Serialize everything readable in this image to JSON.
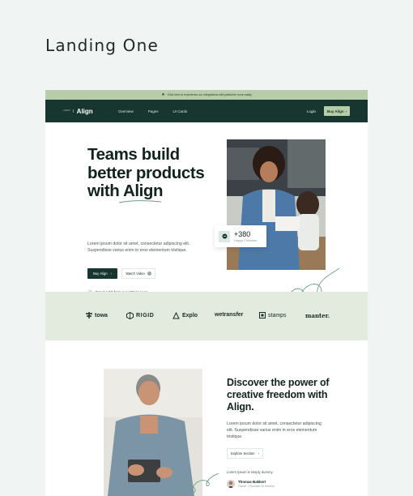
{
  "page_title": "Landing One",
  "announcement": {
    "text": "Click here to experience our integrations with platforms more easily"
  },
  "nav": {
    "brand_mark": "LOGO",
    "brand": "Align",
    "links": [
      "Overview",
      "Pages",
      "UI Cards"
    ],
    "login": "Login",
    "buy": "Buy Align",
    "buy_arrow": "›"
  },
  "hero": {
    "heading_line1": "Teams build",
    "heading_line2": "better products",
    "heading_line3_prefix": "with ",
    "heading_line3_word": "Align",
    "description": "Lorem ipsum dolor sit amet, consectetur adipiscing elit. Suspendisse varius enim in eros elementum tristique.",
    "buy_button": "Buy Align",
    "buy_arrow": "›",
    "watch_button": "Watch Video",
    "rating_text": "Rated 4.9/5 from over 600 reviews.",
    "stat_value": "+380",
    "stat_label": "Happy Customer"
  },
  "logos": [
    "towa",
    "RIGID",
    "Explo",
    "wetransfer",
    "stamps",
    "manter."
  ],
  "feature": {
    "heading": "Discover the power of creative freedom with Align.",
    "description": "Lorem ipsum dolor sit amet, consectetur adipiscing elit. Suspendisse varius enim in eros elementum tristique.",
    "button": "Explore Section",
    "button_arrow": "›",
    "quote": "Lorem Ipsum is simply dummy.",
    "author_name": "Thomas Bakkert",
    "author_role": "Owner • Founder Of Section"
  },
  "colors": {
    "dark_green": "#17362f",
    "sage": "#b7cda9",
    "logo_band": "#e2ebdd",
    "page_bg": "#f0f5f4"
  }
}
